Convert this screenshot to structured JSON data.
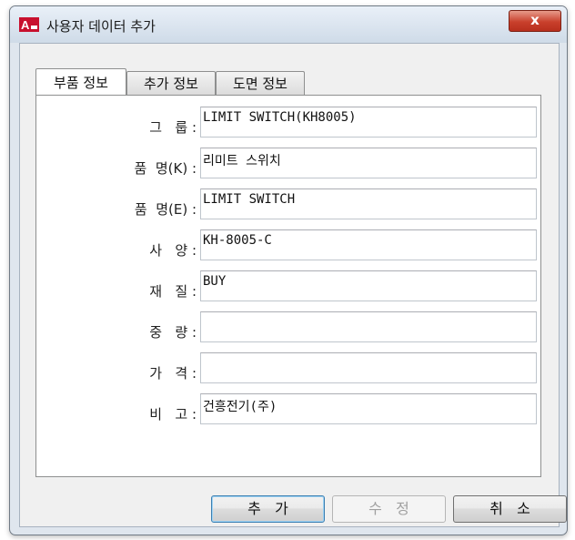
{
  "window": {
    "title": "사용자 데이터 추가",
    "close_label": "x"
  },
  "tabs": [
    {
      "label": "부품 정보"
    },
    {
      "label": "추가 정보"
    },
    {
      "label": "도면 정보"
    }
  ],
  "fields": [
    {
      "label": "그   룹 :",
      "value": "LIMIT SWITCH(KH8005)"
    },
    {
      "label": "품  명(K) :",
      "value": "리미트 스위치"
    },
    {
      "label": "품  명(E) :",
      "value": "LIMIT SWITCH"
    },
    {
      "label": "사   양 :",
      "value": "KH-8005-C"
    },
    {
      "label": "재   질 :",
      "value": "BUY"
    },
    {
      "label": "중   량 :",
      "value": ""
    },
    {
      "label": "가   격 :",
      "value": ""
    },
    {
      "label": "비   고 :",
      "value": "건흥전기(주)"
    }
  ],
  "buttons": {
    "add": "추   가",
    "modify": "수   정",
    "cancel": "취   소"
  },
  "icons": {
    "app": "autocad-icon",
    "close": "close-icon"
  }
}
